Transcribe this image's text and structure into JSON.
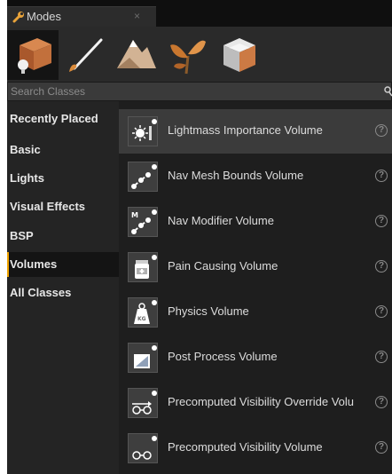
{
  "tab": {
    "title": "Modes",
    "close": "×"
  },
  "modes": [
    {
      "name": "place-mode-button",
      "active": true
    },
    {
      "name": "paint-mode-button",
      "active": false
    },
    {
      "name": "landscape-mode-button",
      "active": false
    },
    {
      "name": "foliage-mode-button",
      "active": false
    },
    {
      "name": "geometry-mode-button",
      "active": false
    }
  ],
  "search": {
    "placeholder": "Search Classes"
  },
  "categories": [
    {
      "label": "Recently Placed",
      "active": false
    },
    {
      "label": "Basic",
      "active": false
    },
    {
      "label": "Lights",
      "active": false
    },
    {
      "label": "Visual Effects",
      "active": false
    },
    {
      "label": "BSP",
      "active": false
    },
    {
      "label": "Volumes",
      "active": true
    },
    {
      "label": "All Classes",
      "active": false
    }
  ],
  "items": [
    {
      "label": "Lightmass Importance Volume",
      "icon": "lightmass-volume-icon",
      "help": "?"
    },
    {
      "label": "Nav Mesh Bounds Volume",
      "icon": "nav-mesh-bounds-icon",
      "help": "?"
    },
    {
      "label": "Nav Modifier Volume",
      "icon": "nav-modifier-icon",
      "help": "?"
    },
    {
      "label": "Pain Causing Volume",
      "icon": "pain-causing-icon",
      "help": "?"
    },
    {
      "label": "Physics Volume",
      "icon": "physics-volume-icon",
      "help": "?"
    },
    {
      "label": "Post Process Volume",
      "icon": "post-process-icon",
      "help": "?"
    },
    {
      "label": "Precomputed Visibility Override Volu",
      "icon": "precomputed-visibility-override-icon",
      "help": "?"
    },
    {
      "label": "Precomputed Visibility Volume",
      "icon": "precomputed-visibility-icon",
      "help": "?"
    }
  ]
}
